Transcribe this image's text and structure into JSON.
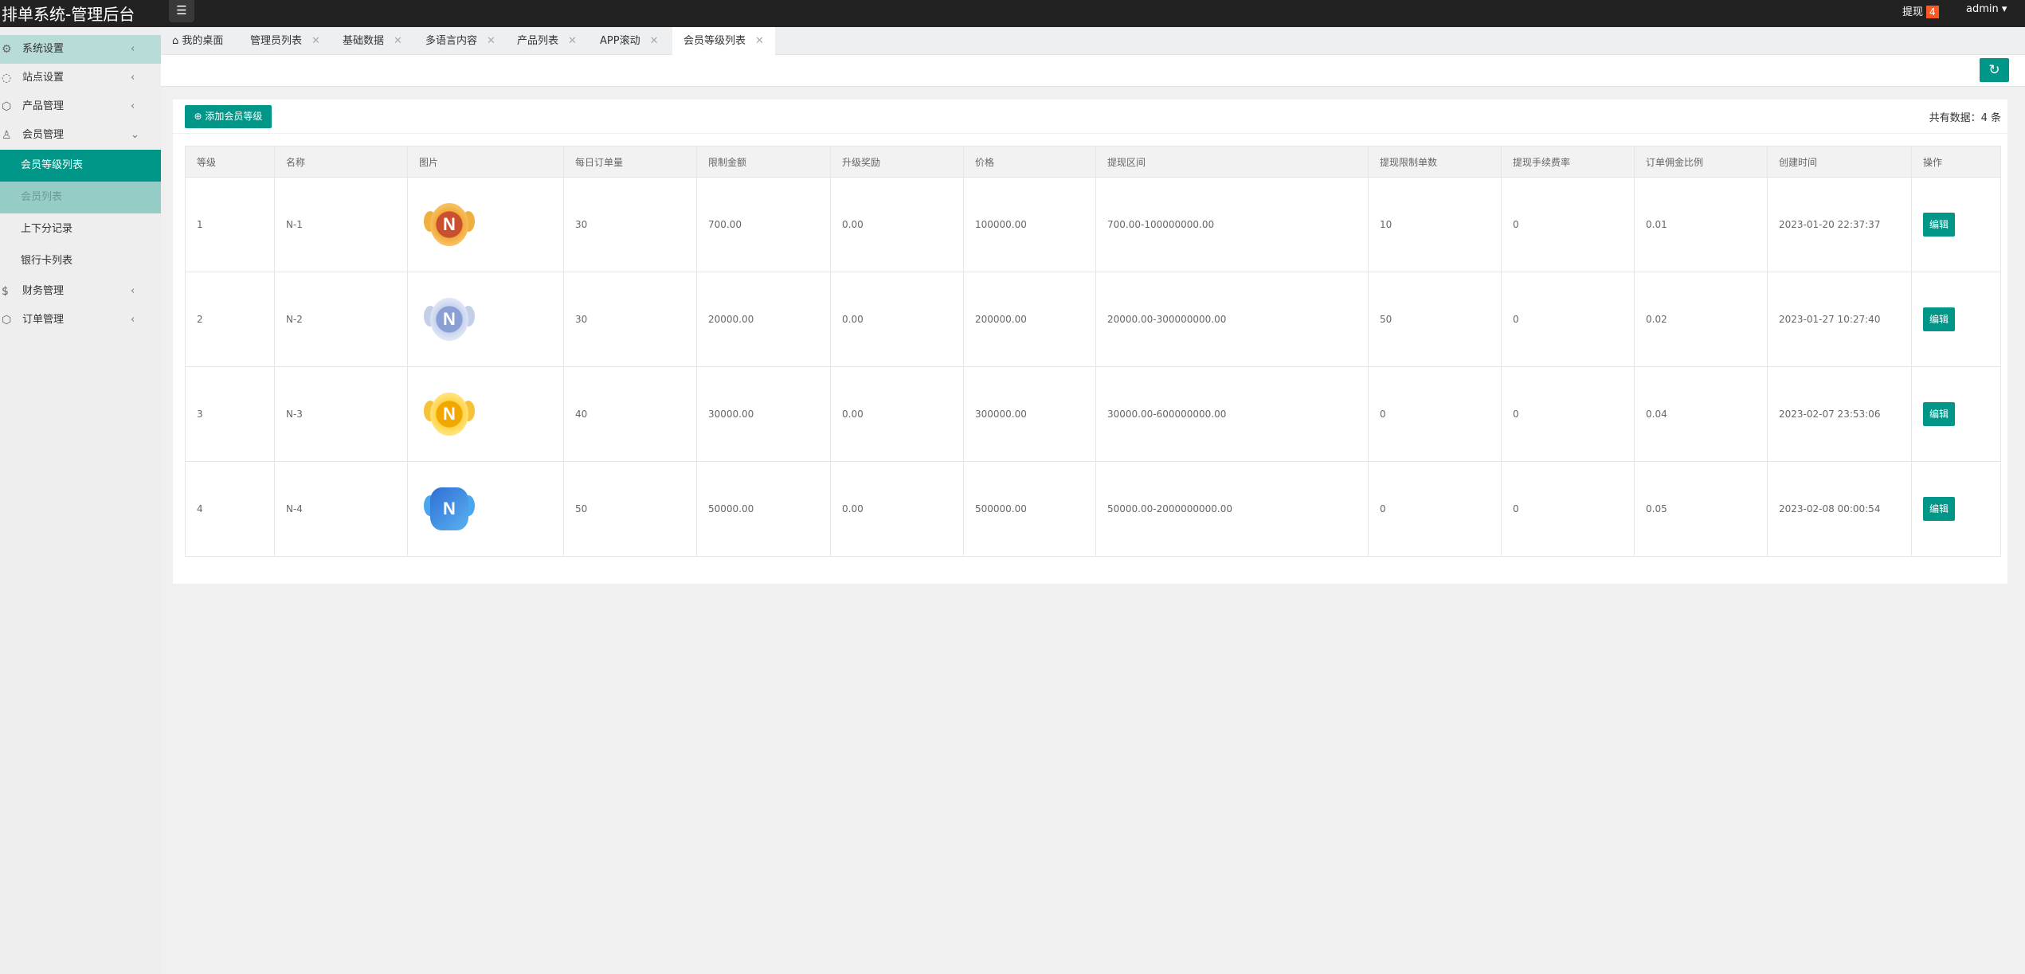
{
  "header": {
    "title": "排单系统-管理后台",
    "withdraw_label": "提现",
    "withdraw_count": "4",
    "user": "admin ▾"
  },
  "sidebar": {
    "items": [
      {
        "label": "系统设置",
        "icon": "gear-icon"
      },
      {
        "label": "站点设置",
        "icon": "bell-icon"
      },
      {
        "label": "产品管理",
        "icon": "box-icon"
      },
      {
        "label": "会员管理",
        "icon": "user-icon"
      },
      {
        "label": "会员等级列表"
      },
      {
        "label": "会员列表"
      },
      {
        "label": "上下分记录"
      },
      {
        "label": "银行卡列表"
      },
      {
        "label": "财务管理",
        "icon": "dollar-icon"
      },
      {
        "label": "订单管理",
        "icon": "box-icon"
      }
    ]
  },
  "tabs": [
    {
      "label": "我的桌面"
    },
    {
      "label": "管理员列表"
    },
    {
      "label": "基础数据"
    },
    {
      "label": "多语言内容"
    },
    {
      "label": "产品列表"
    },
    {
      "label": "APP滚动"
    },
    {
      "label": "会员等级列表"
    }
  ],
  "toolbar": {
    "add_label": "添加会员等级",
    "count_text": "共有数据：4 条"
  },
  "table": {
    "headers": [
      "等级",
      "名称",
      "图片",
      "每日订单量",
      "限制金额",
      "升级奖励",
      "价格",
      "提现区间",
      "提现限制单数",
      "提现手续费率",
      "订单佣金比例",
      "创建时间",
      "操作"
    ],
    "rows": [
      {
        "level": "1",
        "name": "N-1",
        "medal": "bronze",
        "daily": "30",
        "limit": "700.00",
        "reward": "0.00",
        "price": "100000.00",
        "range": "700.00-100000000.00",
        "wd_limit": "10",
        "fee": "0",
        "commission": "0.01",
        "created": "2023-01-20 22:37:37",
        "action": "编辑"
      },
      {
        "level": "2",
        "name": "N-2",
        "medal": "silver",
        "daily": "30",
        "limit": "20000.00",
        "reward": "0.00",
        "price": "200000.00",
        "range": "20000.00-300000000.00",
        "wd_limit": "50",
        "fee": "0",
        "commission": "0.02",
        "created": "2023-01-27 10:27:40",
        "action": "编辑"
      },
      {
        "level": "3",
        "name": "N-3",
        "medal": "gold",
        "daily": "40",
        "limit": "30000.00",
        "reward": "0.00",
        "price": "300000.00",
        "range": "30000.00-600000000.00",
        "wd_limit": "0",
        "fee": "0",
        "commission": "0.04",
        "created": "2023-02-07 23:53:06",
        "action": "编辑"
      },
      {
        "level": "4",
        "name": "N-4",
        "medal": "diamond",
        "daily": "50",
        "limit": "50000.00",
        "reward": "0.00",
        "price": "500000.00",
        "range": "50000.00-2000000000.00",
        "wd_limit": "0",
        "fee": "0",
        "commission": "0.05",
        "created": "2023-02-08 00:00:54",
        "action": "编辑"
      }
    ]
  },
  "colors": {
    "accent": "#009688",
    "header": "#222222",
    "badge": "#ff5722"
  }
}
